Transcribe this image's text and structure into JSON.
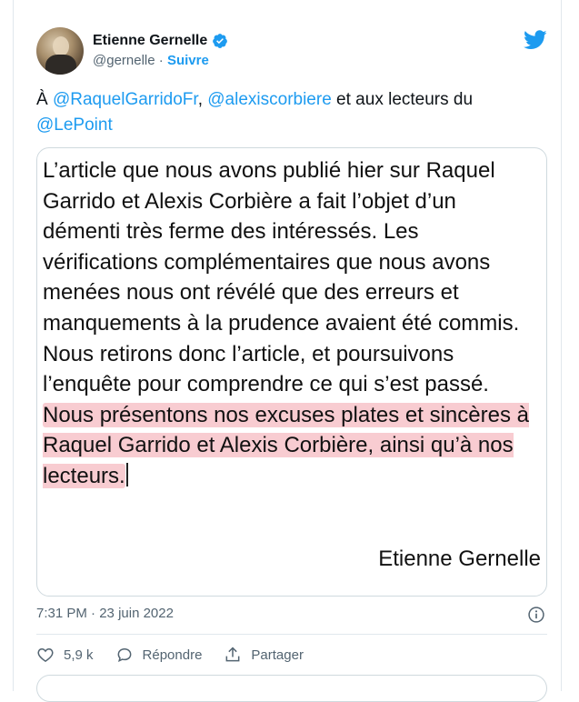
{
  "author": {
    "name": "Etienne Gernelle",
    "handle": "@gernelle",
    "separator": "·",
    "follow_label": "Suivre"
  },
  "tweet": {
    "prefix": "À ",
    "mention1": "@RaquelGarridoFr",
    "comma": ", ",
    "mention2": "@alexiscorbiere",
    "middle": " et aux lecteurs du ",
    "mention3": "@LePoint"
  },
  "letter": {
    "body": "L’article que nous avons publié hier sur Raquel Garrido et Alexis Corbière a fait l’objet d’un démenti très ferme des intéressés. Les vérifications complémentaires que nous avons menées nous ont révélé que des erreurs et manquements à la prudence avaient été commis. Nous retirons donc l’article, et poursuivons l’enquête pour comprendre ce qui s’est passé.",
    "highlighted": "Nous présentons nos excuses plates et sincères à Raquel Garrido et Alexis Corbière, ainsi qu’à nos lecteurs.",
    "signature": "Etienne Gernelle"
  },
  "meta": {
    "time": "7:31 PM",
    "separator": "·",
    "date": "23 juin 2022"
  },
  "actions": {
    "likes": "5,9 k",
    "reply_label": "Répondre",
    "share_label": "Partager"
  },
  "colors": {
    "accent": "#1d9bf0",
    "highlight": "#ec7a85",
    "like": "#536471"
  }
}
